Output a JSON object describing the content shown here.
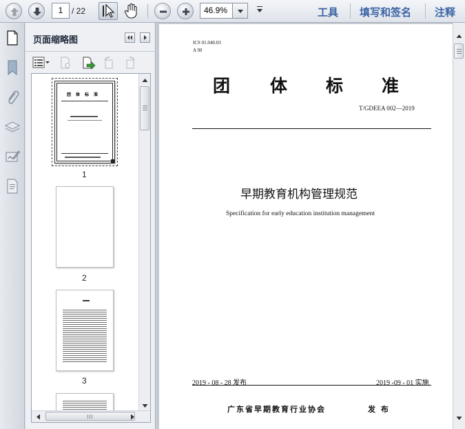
{
  "toolbar": {
    "page_current": "1",
    "page_total": "/ 22",
    "zoom": "46.9%",
    "links": [
      "工具",
      "填写和签名",
      "注释"
    ]
  },
  "panel": {
    "title": "页面缩略图",
    "thumbnails": [
      {
        "label": "1"
      },
      {
        "label": "2"
      },
      {
        "label": "3"
      }
    ]
  },
  "document": {
    "ics": "ICS  01.040.03",
    "ccs": "A 90",
    "header": [
      "团",
      "体",
      "标",
      "准"
    ],
    "standard_no": "T/GDEEA  002—2019",
    "title_cn": "早期教育机构管理规范",
    "title_en": "Specification for early education institution management",
    "issue_date": "2019 - 08 - 28 发布",
    "impl_date": "2019 -09 - 01 实施",
    "publisher": "广东省早期教育行业协会",
    "publish_word": "发 布"
  },
  "colors": {
    "link": "#3b64a3",
    "toolbar_bg": "#e6e9ee"
  }
}
